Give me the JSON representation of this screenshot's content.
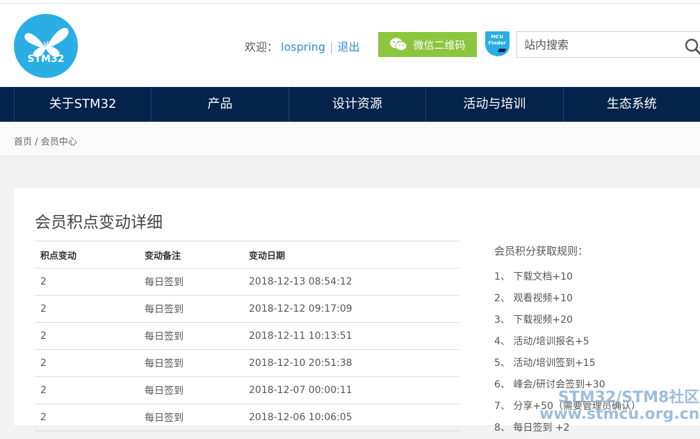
{
  "header": {
    "logo_text": "STM32",
    "welcome_label": "欢迎：",
    "username": "lospring",
    "separator": "|",
    "logout_label": "退出",
    "wechat_button_label": "微信二维码",
    "mcu_finder_label_1": "MCU",
    "mcu_finder_label_2": "Finder",
    "search_placeholder": "站内搜索"
  },
  "nav": {
    "items": [
      {
        "label": "关于STM32"
      },
      {
        "label": "产品"
      },
      {
        "label": "设计资源"
      },
      {
        "label": "活动与培训"
      },
      {
        "label": "生态系统"
      }
    ]
  },
  "breadcrumb": {
    "home": "首页",
    "separator": "/",
    "current": "会员中心"
  },
  "main": {
    "title": "会员积点变动详细",
    "table": {
      "headers": [
        "积点变动",
        "变动备注",
        "变动日期"
      ],
      "rows": [
        [
          "2",
          "每日签到",
          "2018-12-13 08:54:12"
        ],
        [
          "2",
          "每日签到",
          "2018-12-12 09:17:09"
        ],
        [
          "2",
          "每日签到",
          "2018-12-11 10:13:51"
        ],
        [
          "2",
          "每日签到",
          "2018-12-10 20:51:38"
        ],
        [
          "2",
          "每日签到",
          "2018-12-07 00:00:11"
        ],
        [
          "2",
          "每日签到",
          "2018-12-06 10:06:05"
        ]
      ]
    },
    "rules": {
      "title": "会员积分获取规则：",
      "items": [
        "1、 下载文档+10",
        "2、 观看视频+10",
        "3、 下载视频+20",
        "4、 活动/培训报名+5",
        "5、 活动/培训签到+15",
        "6、 峰会/研讨会签到+30",
        "7、 分享+50（需要管理员确认）",
        "8、 每日签到 +2"
      ]
    }
  },
  "watermark": {
    "line1": "STM32/STM8社区",
    "line2": "www.stmcu.org.cn"
  },
  "colors": {
    "nav_bg": "#03234b",
    "accent_blue": "#2aaee3",
    "link_blue": "#2c8fd1",
    "wechat_green": "#8cc63f"
  }
}
